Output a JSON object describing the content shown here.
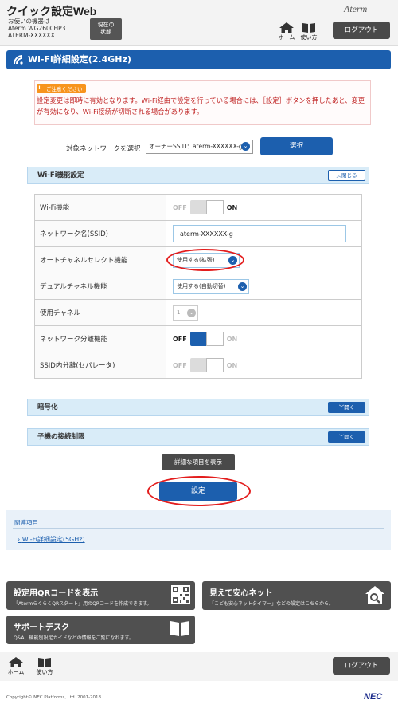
{
  "header": {
    "app_title": "クイック設定Web",
    "device_lines": [
      "お使いの機器は",
      "Aterm WG2600HP3",
      "ATERM-XXXXXX"
    ],
    "status_button": [
      "現在の",
      "状態"
    ],
    "brand_logo": "Aterm",
    "home_label": "ホーム",
    "howto_label": "使い方",
    "logout_label": "ログアウト"
  },
  "page_title": "Wi-Fi詳細設定(2.4GHz)",
  "notice": {
    "badge": "ご注意ください",
    "text": "設定変更は即時に有効となります。Wi-Fi経由で設定を行っている場合には、［設定］ボタンを押したあと、変更が有効になり、Wi-Fi接続が切断される場合があります。"
  },
  "target_network": {
    "label": "対象ネットワークを選択",
    "selected": "オーナーSSID：aterm-XXXXXX-g",
    "button": "選択"
  },
  "wifi_function_panel": {
    "title": "Wi-Fi機能設定",
    "toggle": "閉じる",
    "rows": [
      {
        "label": "Wi-Fi機能",
        "off": "OFF",
        "on": "ON"
      },
      {
        "label": "ネットワーク名(SSID)",
        "value": "aterm-XXXXXX-g"
      },
      {
        "label": "オートチャネルセレクト機能",
        "value": "使用する(拡張)"
      },
      {
        "label": "デュアルチャネル機能",
        "value": "使用する(自動切替)"
      },
      {
        "label": "使用チャネル",
        "value": "1"
      },
      {
        "label": "ネットワーク分離機能",
        "off": "OFF",
        "on": "ON"
      },
      {
        "label": "SSID内分離(セパレータ)",
        "off": "OFF",
        "on": "ON"
      }
    ]
  },
  "encryption_panel": {
    "title": "暗号化",
    "toggle": "開く"
  },
  "client_limit_panel": {
    "title": "子機の接続制限",
    "toggle": "開く"
  },
  "actions": {
    "show_details": "詳細な項目を表示",
    "save": "設定"
  },
  "related": {
    "title": "関連項目",
    "link": "Wi-Fi詳細設定(5GHz)"
  },
  "cards": {
    "qr": {
      "title": "設定用QRコードを表示",
      "desc": "「AtermらくらくQRスタート」用のQRコードを作成できます。"
    },
    "safety": {
      "title": "見えて安心ネット",
      "desc": "「こども安心ネットタイマー」などの設定はこちらから。"
    },
    "support": {
      "title": "サポートデスク",
      "desc": "Q&A、機能別設定ガイドなどの情報をご覧になれます。"
    }
  },
  "footer": {
    "home_label": "ホーム",
    "howto_label": "使い方",
    "logout_label": "ログアウト",
    "copyright": "Copyright© NEC Platforms, Ltd. 2001-2018",
    "brand_logo": "NEC"
  },
  "colors": {
    "primary": "#1c5fae",
    "notice_red": "#c02424",
    "highlight_ring": "#e31d1d",
    "dark_button": "#4a4a4a"
  }
}
